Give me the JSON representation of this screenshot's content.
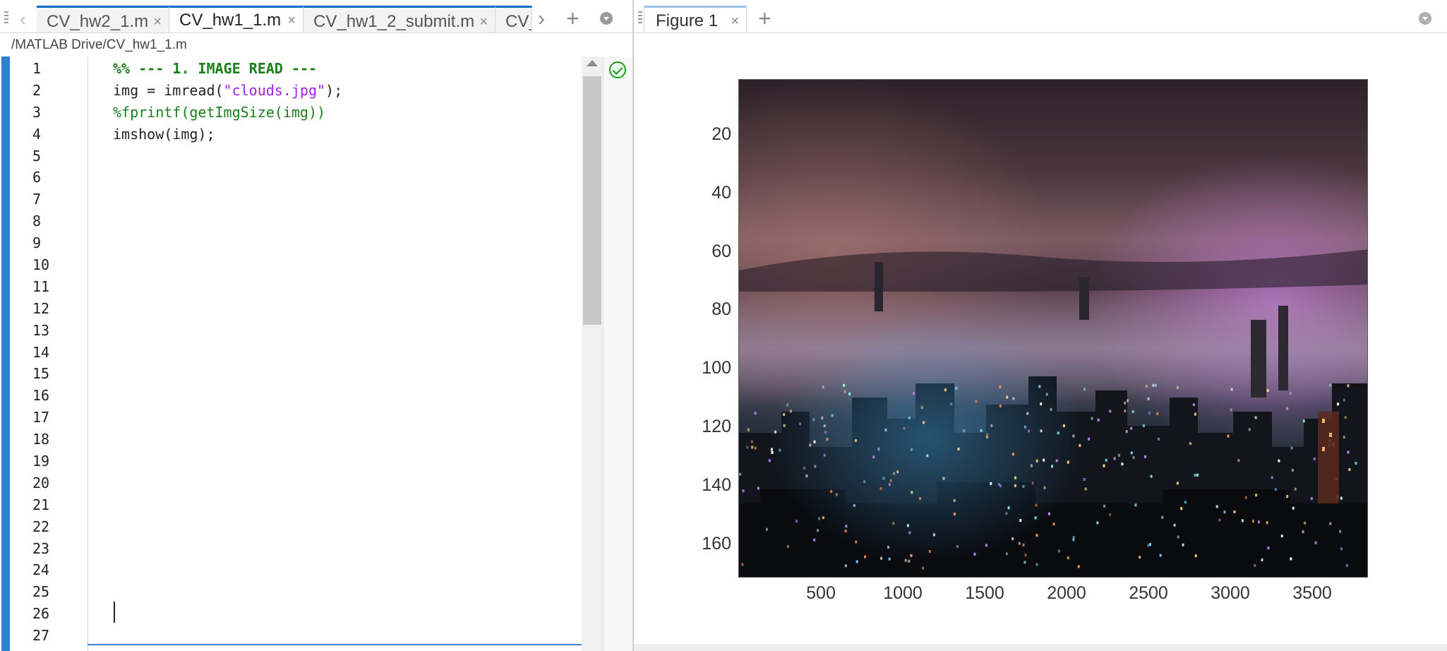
{
  "editor": {
    "tabs": [
      {
        "label": "CV_hw2_1.m",
        "close": "×"
      },
      {
        "label": "CV_hw1_1.m",
        "close": "×"
      },
      {
        "label": "CV_hw1_2_submit.m",
        "close": "×"
      },
      {
        "label": "CV_",
        "close": ""
      }
    ],
    "nav_left": "‹",
    "nav_next": "›",
    "add_tab": "+",
    "file_path": "/MATLAB Drive/CV_hw1_1.m",
    "line_numbers": [
      "1",
      "2",
      "3",
      "4",
      "5",
      "6",
      "7",
      "8",
      "9",
      "10",
      "11",
      "12",
      "13",
      "14",
      "15",
      "16",
      "17",
      "18",
      "19",
      "20",
      "21",
      "22",
      "23",
      "24",
      "25",
      "26",
      "27"
    ],
    "code": {
      "line1": "%% --- 1. IMAGE READ ---",
      "line2_pre": "img = imread(",
      "line2_str": "\"clouds.jpg\"",
      "line2_post": ");",
      "line3": "%fprintf(getImgSize(img))",
      "line4": "imshow(img);"
    },
    "status_icon": "check-circle-icon"
  },
  "figure": {
    "tab_label": "Figure 1",
    "tab_close": "×",
    "add_tab": "+",
    "image_desc_colors": {
      "sky_top": "#3a2a30",
      "haze": "#8a6f78",
      "city": "#121a24",
      "accent_purple": "#c77be0",
      "accent_blue": "#3aa3e0",
      "accent_orange": "#e07a3a"
    },
    "y_ticks": [
      "20",
      "40",
      "60",
      "80",
      "100",
      "120",
      "140",
      "160"
    ],
    "x_ticks": [
      "500",
      "1000",
      "1500",
      "2000",
      "2500",
      "3000",
      "3500"
    ]
  }
}
